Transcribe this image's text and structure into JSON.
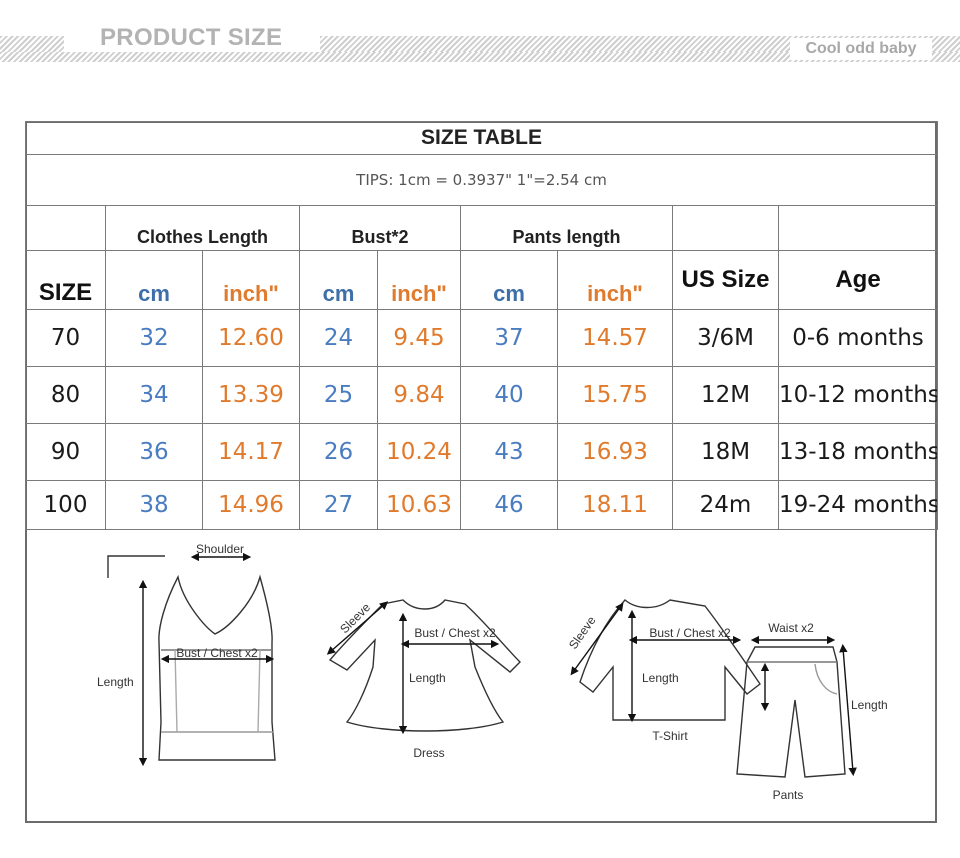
{
  "header": {
    "title": "PRODUCT SIZE",
    "brand": "Cool odd baby"
  },
  "table": {
    "title": "SIZE TABLE",
    "tips": "TIPS: 1cm = 0.3937\"   1\"=2.54 cm",
    "groups": {
      "clothes_length": "Clothes Length",
      "bust": "Bust*2",
      "pants_length": "Pants length"
    },
    "columns": {
      "size": "SIZE",
      "cm": "cm",
      "inch": "inch\"",
      "us_size": "US Size",
      "age": "Age"
    },
    "rows": [
      [
        "70",
        "32",
        "12.60",
        "24",
        "9.45",
        "37",
        "14.57",
        "3/6M",
        "0-6 months"
      ],
      [
        "80",
        "34",
        "13.39",
        "25",
        "9.84",
        "40",
        "15.75",
        "12M",
        "10-12 months"
      ],
      [
        "90",
        "36",
        "14.17",
        "26",
        "10.24",
        "43",
        "16.93",
        "18M",
        "13-18 months"
      ],
      [
        "100",
        "38",
        "14.96",
        "27",
        "10.63",
        "46",
        "18.11",
        "24m",
        "19-24 months"
      ]
    ]
  },
  "diagram": {
    "vest": {
      "shoulder": "Shoulder",
      "bust": "Bust / Chest x2",
      "length": "Length"
    },
    "dress": {
      "sleeve": "Sleeve",
      "bust": "Bust / Chest x2",
      "length": "Length",
      "name": "Dress"
    },
    "tshirt": {
      "sleeve": "Sleeve",
      "bust": "Bust / Chest x2",
      "length": "Length",
      "name": "T-Shirt"
    },
    "pants": {
      "waist": "Waist x2",
      "length": "Length",
      "name": "Pants"
    }
  }
}
